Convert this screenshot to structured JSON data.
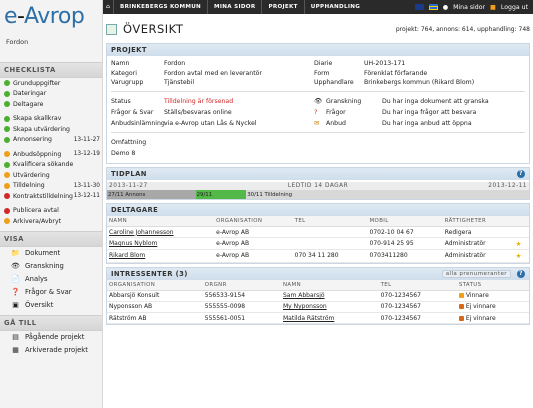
{
  "logo": "e-Avrop",
  "org": "Fordon",
  "nav": {
    "crumbs": [
      "BRINKEBERGS KOMMUN",
      "MINA SIDOR",
      "PROJEKT",
      "UPPHANDLING"
    ],
    "mina_sidor": "Mina sidor",
    "logga_ut": "Logga ut"
  },
  "checklista": {
    "heading": "CHECKLISTA",
    "items": [
      {
        "label": "Grunduppgifter",
        "date": "",
        "status": "g"
      },
      {
        "label": "Dateringar",
        "date": "",
        "status": "g"
      },
      {
        "label": "Deltagare",
        "date": "",
        "status": "g"
      },
      {
        "label": "Skapa skallkrav",
        "date": "",
        "status": "g"
      },
      {
        "label": "Skapa utvärdering",
        "date": "",
        "status": "g"
      },
      {
        "label": "Annonsering",
        "date": "13-11-27",
        "status": "g"
      },
      {
        "label": "Anbudsöppning",
        "date": "13-12-19",
        "status": "o"
      },
      {
        "label": "Kvalificera sökande",
        "date": "",
        "status": "g"
      },
      {
        "label": "Utvärdering",
        "date": "",
        "status": "o"
      },
      {
        "label": "Tilldelning",
        "date": "13-11-30",
        "status": "o"
      },
      {
        "label": "Kontraktstilldelning",
        "date": "13-12-11",
        "status": "r"
      },
      {
        "label": "Publicera avtal",
        "date": "",
        "status": "r"
      },
      {
        "label": "Arkivera/Avbryt",
        "date": "",
        "status": "o"
      }
    ]
  },
  "visa": {
    "heading": "VISA",
    "items": [
      {
        "label": "Dokument",
        "icon": "folder-icon"
      },
      {
        "label": "Granskning",
        "icon": "eye-icon"
      },
      {
        "label": "Analys",
        "icon": "chart-icon"
      },
      {
        "label": "Frågor & Svar",
        "icon": "question-icon"
      },
      {
        "label": "Översikt",
        "icon": "overview-icon"
      }
    ]
  },
  "ga_till": {
    "heading": "GÅ TILL",
    "items": [
      {
        "label": "Pågående projekt",
        "icon": "list-icon"
      },
      {
        "label": "Arkiverade projekt",
        "icon": "archive-icon"
      }
    ]
  },
  "page": {
    "title": "ÖVERSIKT",
    "stats": "projekt: 764, annons: 614, upphandling: 748"
  },
  "projekt": {
    "heading": "PROJEKT",
    "namn_label": "Namn",
    "namn": "Fordon",
    "diarie_label": "Diarie",
    "diarie": "UH-2013-171",
    "kategori_label": "Kategori",
    "kategori": "Fordon avtal med en leverantör",
    "form_label": "Form",
    "form": "Förenklat förfarande",
    "varugrupp_label": "Varugrupp",
    "varugrupp": "Tjänstebil",
    "upphandlare_label": "Upphandlare",
    "upphandlare": "Brinkebergs kommun (Rikard Blom)",
    "status_label": "Status",
    "status": "Tilldelning är försenad",
    "fs_label": "Frågor & Svar",
    "fs": "Ställs/besvaras online",
    "anbud_label": "Anbudsinlämning",
    "anbud": "via e-Avrop utan Lås & Nyckel",
    "granskning_label": "Granskning",
    "granskning": "Du har inga dokument att granska",
    "fragor_label": "Frågor",
    "fragor": "Du har inga frågor att besvara",
    "anbud2_label": "Anbud",
    "anbud2": "Du har inga anbud att öppna",
    "omfattning_label": "Omfattning",
    "omfattning": "Demo 8"
  },
  "tidplan": {
    "heading": "TIDPLAN",
    "start": "2013-11-27",
    "mid": "LEDTID 14 DAGAR",
    "end": "2013-12-11",
    "segments": [
      {
        "label": "27/11 Annons",
        "color": "#a8a8a8",
        "width_pct": 21
      },
      {
        "label": "29/11",
        "color": "#52b848",
        "width_pct": 12
      },
      {
        "label": "30/11 Tilldelning",
        "color": "#d8d8d8",
        "width_pct": 67
      }
    ]
  },
  "deltagare": {
    "heading": "DELTAGARE",
    "cols": [
      "NAMN",
      "ORGANISATION",
      "TEL",
      "MOBIL",
      "RÄTTIGHETER"
    ],
    "rows": [
      {
        "namn": "Caroline Johannesson",
        "org": "e-Avrop AB",
        "tel": "",
        "mobil": "0702-10 04 67",
        "rt": "Redigera",
        "star": false
      },
      {
        "namn": "Magnus Nyblom",
        "org": "e-Avrop AB",
        "tel": "",
        "mobil": "070-914 25 95",
        "rt": "Administratör",
        "star": true
      },
      {
        "namn": "Rikard Blom",
        "org": "e-Avrop AB",
        "tel": "070 34 11 280",
        "mobil": "0703411280",
        "rt": "Administratör",
        "star": true
      }
    ]
  },
  "intressenter": {
    "heading": "INTRESSENTER (3)",
    "alla": "alla prenumeranter",
    "cols": [
      "ORGANISATION",
      "ORGNR",
      "NAMN",
      "TEL",
      "STATUS"
    ],
    "rows": [
      {
        "org": "Abbarsjö Konsult",
        "orgnr": "556533-9154",
        "namn": "Sam Abbarsjö",
        "tel": "070-1234567",
        "status": "Vinnare",
        "color": "#f0a018"
      },
      {
        "org": "Nyponsson AB",
        "orgnr": "555555-0098",
        "namn": "My Nyponsson",
        "tel": "070-1234567",
        "status": "Ej vinnare",
        "color": "#d86818"
      },
      {
        "org": "Rätström AB",
        "orgnr": "555561-0051",
        "namn": "Matilda Rätström",
        "tel": "070-1234567",
        "status": "Ej vinnare",
        "color": "#d86818"
      }
    ]
  }
}
